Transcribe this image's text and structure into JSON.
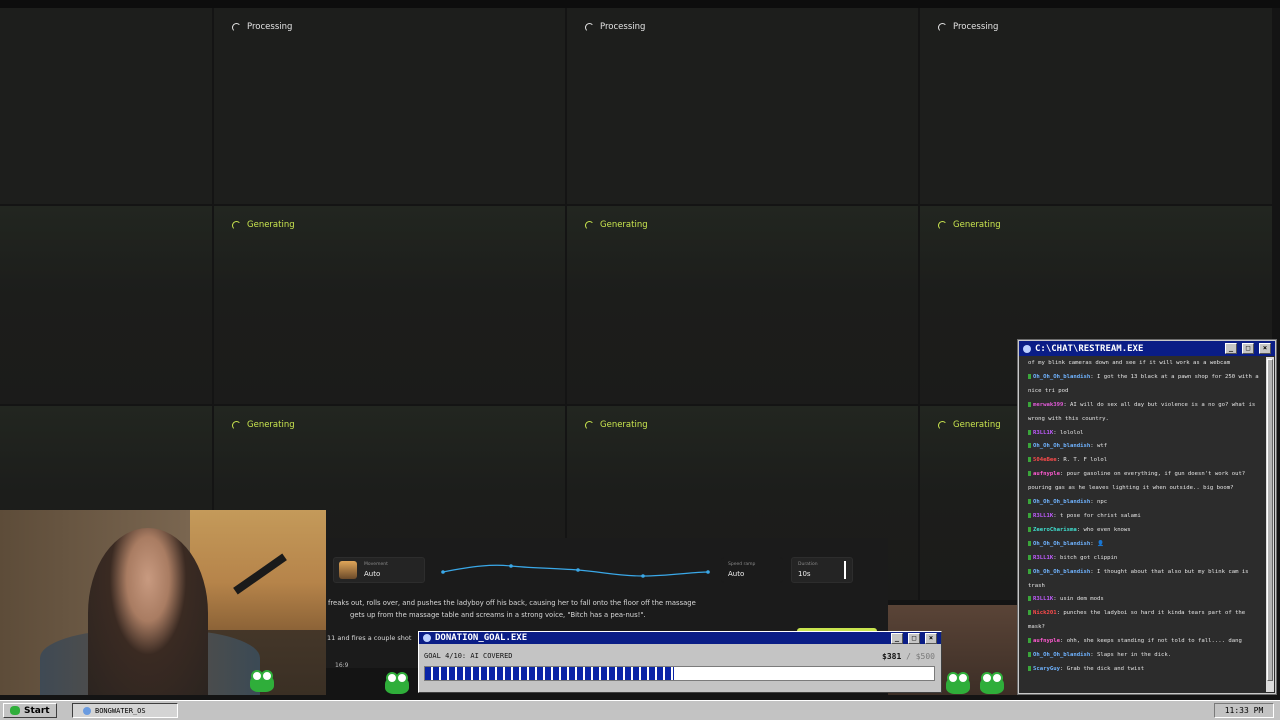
{
  "grid": {
    "row1": [
      "Processing",
      "Processing",
      "Processing"
    ],
    "row2": [
      "Generating",
      "Generating",
      "Generating"
    ],
    "row3": [
      "Generating",
      "Generating",
      "Generating"
    ]
  },
  "chat": {
    "title": "C:\\CHAT\\RESTREAM.EXE",
    "messages": [
      {
        "user": "",
        "text": "of my blink cameras down and see if it will work as a webcam",
        "color": "#e6e6e6"
      },
      {
        "user": "Oh_Oh_Oh_blandish",
        "text": ": I got the 13 black at a pawn shop for 250 with a nice tri pod",
        "color": "#6fb3ff"
      },
      {
        "user": "merwak399",
        "text": ": AI will do sex all day but violence is a no go? what is wrong with this country.",
        "color": "#e05ad6"
      },
      {
        "user": "R3LL1K",
        "text": ": lololol",
        "color": "#c05cff"
      },
      {
        "user": "Oh_Oh_Oh_blandish",
        "text": ": wtf",
        "color": "#6fb3ff"
      },
      {
        "user": "504eBee",
        "text": ": R. T. F lolol",
        "color": "#ff4b4b"
      },
      {
        "user": "aufnyple",
        "text": ": pour gasoline on everything, if gun doesn't work out? pouring gas as he leaves lighting it when outside.. big boom?",
        "color": "#ff5ad1"
      },
      {
        "user": "Oh_Oh_Oh_blandish",
        "text": ": npc",
        "color": "#6fb3ff"
      },
      {
        "user": "R3LL1K",
        "text": ": t pose for christ salami",
        "color": "#c05cff"
      },
      {
        "user": "ZeeroCharisma",
        "text": ": who even knows",
        "color": "#3fe0d0"
      },
      {
        "user": "Oh_Oh_Oh_blandish",
        "text": ": 👤",
        "color": "#6fb3ff"
      },
      {
        "user": "R3LL1K",
        "text": ": bitch got clippin",
        "color": "#c05cff"
      },
      {
        "user": "Oh_Oh_Oh_blandish",
        "text": ": I thought about that also but my blink cam is trash",
        "color": "#6fb3ff"
      },
      {
        "user": "R3LL1K",
        "text": ": usin dem mods",
        "color": "#c05cff"
      },
      {
        "user": "Nick201",
        "text": ": punches the ladyboi so hard it kinda tears part of the mask?",
        "color": "#ff4b4b"
      },
      {
        "user": "aufnyple",
        "text": ": ohh, she keeps standing if not told to fall.... dang",
        "color": "#ff5ad1"
      },
      {
        "user": "Oh_Oh_Oh_blandish",
        "text": ": Slaps her in the dick.",
        "color": "#6fb3ff"
      },
      {
        "user": "ScaryGuy",
        "text": ": Grab the dick and twist",
        "color": "#6fb3ff"
      }
    ]
  },
  "controls": {
    "movement_label": "Movement",
    "movement_value": "Auto",
    "speed_label": "Speed ramp",
    "speed_value": "Auto",
    "duration_label": "Duration",
    "duration_value": "10s"
  },
  "prompt": {
    "line1": "freaks out, rolls over, and pushes the ladyboy off his back, causing her to fall onto the floor off the massage",
    "line2": "gets up from the massage table and screams in a strong voice, \"Bitch has a pea-nus!\".",
    "line3": "11 and fires a couple shot",
    "aspect": "16:9"
  },
  "donation": {
    "title": "DONATION_GOAL.EXE",
    "goal_text": "GOAL 4/10: AI COVERED",
    "raised": "$381",
    "separator": " / ",
    "target": "$500",
    "progress": 0.49
  },
  "taskbar": {
    "start_label": "Start",
    "task_label": "BONGWATER_OS",
    "clock": "11:33 PM"
  },
  "colors": {
    "generating": "#c9e54f",
    "titlebar": "#0a1d86",
    "progress": "#0a24a6"
  }
}
